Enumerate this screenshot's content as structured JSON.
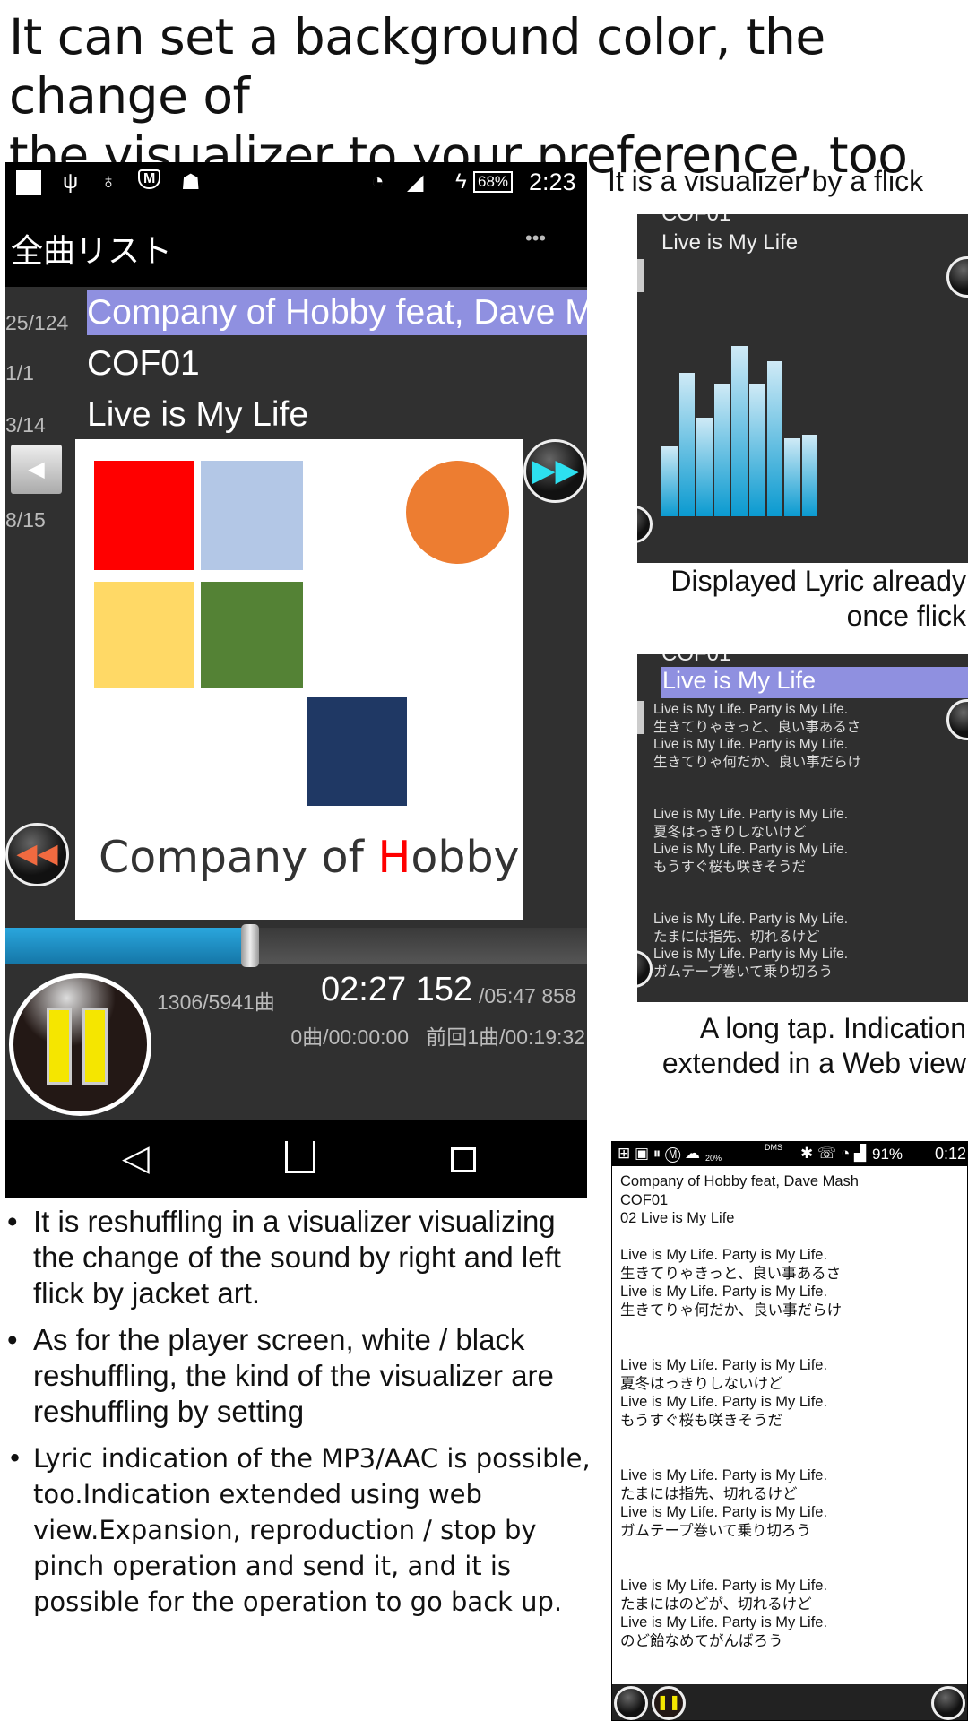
{
  "headline": [
    "It can set a background color, the change of",
    "the visualizer to your preference, too"
  ],
  "phone": {
    "status": {
      "battery": "68%",
      "time": "2:23",
      "icons": [
        "notification-square-icon",
        "usb-icon",
        "bulb-icon",
        "m-shield-icon",
        "android-icon",
        "wifi-icon",
        "signal-icon",
        "charging-icon",
        "battery-icon"
      ]
    },
    "title": "全曲リスト",
    "menu_label": "•••",
    "rows": [
      {
        "counter": "25/124",
        "text": "Company of Hobby feat, Dave M",
        "highlight": "#8f90e0"
      },
      {
        "counter": "1/1",
        "text": "COF01"
      },
      {
        "counter": "3/14",
        "text": "Live is My Life"
      },
      {
        "counter": "8/15",
        "text": ""
      }
    ],
    "album_art": {
      "title_prefix": "Company of ",
      "title_accent": "H",
      "title_suffix": "obby",
      "colors": {
        "red": "#ff0000",
        "light_blue": "#b3c7e6",
        "yellow": "#ffd966",
        "green": "#548235",
        "navy": "#1f3864",
        "orange": "#ed7d31"
      }
    },
    "seek_progress": 0.42,
    "counts": "1306/5941曲",
    "elapsed": "02:27 152",
    "total": "/05:47 858",
    "queue": "0曲/00:00:00",
    "previous": "前回1曲/00:19:32",
    "accent": "#2aa6dd"
  },
  "panels": {
    "caption1": "It is a visualizer by a flick",
    "vis_title_cut": "COF01",
    "vis_track": "Live is My Life",
    "vis_levels": [
      0.41,
      0.84,
      0.58,
      0.78,
      1.0,
      0.78,
      0.91,
      0.46,
      0.48
    ],
    "caption2": [
      "Displayed Lyric already",
      "once flick"
    ],
    "lyric_track": "Live is My Life",
    "lyrics": [
      "Live is My Life. Party is My Life.",
      "生きてりゃきっと、良い事あるさ",
      "Live is My Life. Party is My Life.",
      "生きてりゃ何だか、良い事だらけ",
      "",
      "",
      "Live is My Life. Party is My Life.",
      "夏冬はっきりしないけど",
      "Live is My Life. Party is My Life.",
      "もうすぐ桜も咲きそうだ",
      "",
      "",
      "Live is My Life. Party is My Life.",
      "たまには指先、切れるけど",
      "Live is My Life. Party is My Life.",
      "ガムテープ巻いて乗り切ろう"
    ],
    "caption3": [
      "A long tap. Indication",
      "extended in a Web view"
    ]
  },
  "web": {
    "status": {
      "weather": "20%",
      "dms": "DMS",
      "battery": "91%",
      "time": "0:12"
    },
    "header": [
      "Company of Hobby feat, Dave Mash",
      "COF01",
      "02 Live is My Life"
    ],
    "lyrics": [
      "",
      "Live is My Life. Party is My Life.",
      "生きてりゃきっと、良い事あるさ",
      "Live is My Life. Party is My Life.",
      "生きてりゃ何だか、良い事だらけ",
      "",
      "",
      "Live is My Life. Party is My Life.",
      "夏冬はっきりしないけど",
      "Live is My Life. Party is My Life.",
      "もうすぐ桜も咲きそうだ",
      "",
      "",
      "Live is My Life. Party is My Life.",
      "たまには指先、切れるけど",
      "Live is My Life. Party is My Life.",
      "ガムテープ巻いて乗り切ろう",
      "",
      "",
      "Live is My Life. Party is My Life.",
      "たまにはのどが、切れるけど",
      "Live is My Life. Party is My Life.",
      "のど飴なめてがんばろう"
    ]
  },
  "bullets": [
    "It is reshuffling in a visualizer visualizing the change of the sound by right and left flick by jacket art.",
    "As for the player screen, white / black reshuffling, the kind of the visualizer are reshuffling by setting",
    "Lyric indication of the MP3/AAC is possible, too.Indication extended using web view.Expansion, reproduction / stop by pinch operation and send it, and it is possible for the operation to go back up."
  ]
}
